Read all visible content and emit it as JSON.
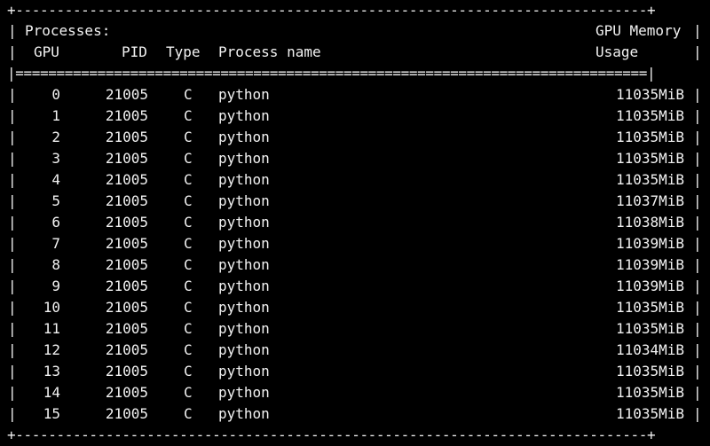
{
  "terminal": {
    "top_border": "+-----------------------------------------------------------------------------+",
    "bottom_border": "+-----------------------------------------------------------------------------+",
    "separator": "|=============================================================================|",
    "header": {
      "title": "Processes:",
      "gpu_memory_label": "GPU Memory",
      "col_gpu": "GPU",
      "col_pid": "PID",
      "col_type": "Type",
      "col_process_name": "Process name",
      "col_usage": "Usage"
    },
    "pipe": "|",
    "processes": [
      {
        "gpu": "0",
        "pid": "21005",
        "type": "C",
        "name": "python",
        "memory": "11035MiB"
      },
      {
        "gpu": "1",
        "pid": "21005",
        "type": "C",
        "name": "python",
        "memory": "11035MiB"
      },
      {
        "gpu": "2",
        "pid": "21005",
        "type": "C",
        "name": "python",
        "memory": "11035MiB"
      },
      {
        "gpu": "3",
        "pid": "21005",
        "type": "C",
        "name": "python",
        "memory": "11035MiB"
      },
      {
        "gpu": "4",
        "pid": "21005",
        "type": "C",
        "name": "python",
        "memory": "11035MiB"
      },
      {
        "gpu": "5",
        "pid": "21005",
        "type": "C",
        "name": "python",
        "memory": "11037MiB"
      },
      {
        "gpu": "6",
        "pid": "21005",
        "type": "C",
        "name": "python",
        "memory": "11038MiB"
      },
      {
        "gpu": "7",
        "pid": "21005",
        "type": "C",
        "name": "python",
        "memory": "11039MiB"
      },
      {
        "gpu": "8",
        "pid": "21005",
        "type": "C",
        "name": "python",
        "memory": "11039MiB"
      },
      {
        "gpu": "9",
        "pid": "21005",
        "type": "C",
        "name": "python",
        "memory": "11039MiB"
      },
      {
        "gpu": "10",
        "pid": "21005",
        "type": "C",
        "name": "python",
        "memory": "11035MiB"
      },
      {
        "gpu": "11",
        "pid": "21005",
        "type": "C",
        "name": "python",
        "memory": "11035MiB"
      },
      {
        "gpu": "12",
        "pid": "21005",
        "type": "C",
        "name": "python",
        "memory": "11034MiB"
      },
      {
        "gpu": "13",
        "pid": "21005",
        "type": "C",
        "name": "python",
        "memory": "11035MiB"
      },
      {
        "gpu": "14",
        "pid": "21005",
        "type": "C",
        "name": "python",
        "memory": "11035MiB"
      },
      {
        "gpu": "15",
        "pid": "21005",
        "type": "C",
        "name": "python",
        "memory": "11035MiB"
      }
    ]
  }
}
